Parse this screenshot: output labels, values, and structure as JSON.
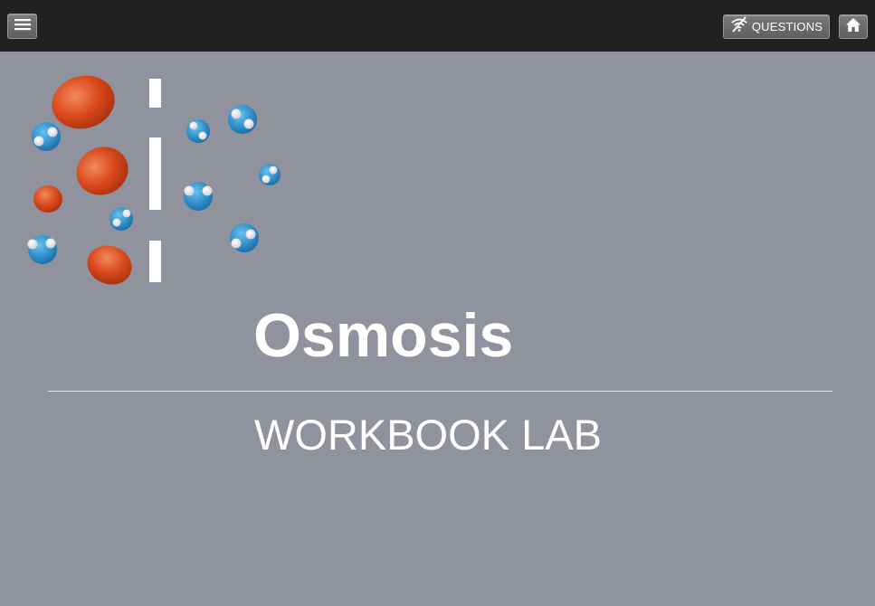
{
  "toolbar": {
    "menu_icon": "hamburger-menu-icon",
    "questions_label": "QUESTIONS",
    "questions_icon": "wifi-off-icon",
    "home_icon": "home-icon"
  },
  "main": {
    "title": "Osmosis",
    "subtitle": "WORKBOOK LAB"
  },
  "colors": {
    "topbar": "#212121",
    "background": "#90929e",
    "solute": "#d9491c",
    "water": "#2f8fca"
  }
}
